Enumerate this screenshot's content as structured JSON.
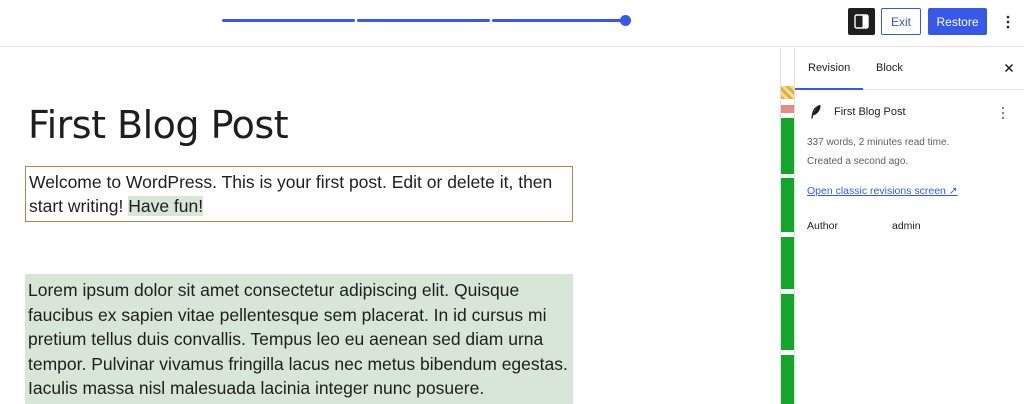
{
  "topbar": {
    "exit_label": "Exit",
    "restore_label": "Restore"
  },
  "slider": {
    "position_fraction": 1.0
  },
  "editor": {
    "title": "First Blog Post",
    "paragraph1_text": "Welcome to WordPress. This is your first post. Edit or delete it, then start writing! ",
    "paragraph1_added": "Have fun!",
    "paragraph2_text": "Lorem ipsum dolor sit amet consectetur adipiscing elit. Quisque faucibus ex sapien vitae pellentesque sem placerat. In id cursus mi pretium tellus duis convallis. Tempus leo eu aenean sed diam urna tempor. Pulvinar vivamus fringilla lacus nec metus bibendum egestas. Iaculis massa nisl malesuada lacinia integer nunc posuere."
  },
  "sidebar": {
    "tabs": [
      {
        "label": "Revision",
        "active": true
      },
      {
        "label": "Block",
        "active": false
      }
    ],
    "post_name": "First Blog Post",
    "meta_line1": "337 words, 2 minutes read time.",
    "meta_line2": "Created a second ago.",
    "classic_link": "Open classic revisions screen ↗",
    "author_label": "Author",
    "author_value": "admin"
  },
  "colors": {
    "accent": "#3858e9",
    "added_highlight": "#d7e6d6",
    "selected_border": "#a8894b",
    "stripe_added": "#14a52b",
    "stripe_removed": "#e58b8b",
    "stripe_modified": "#e2b33a"
  }
}
